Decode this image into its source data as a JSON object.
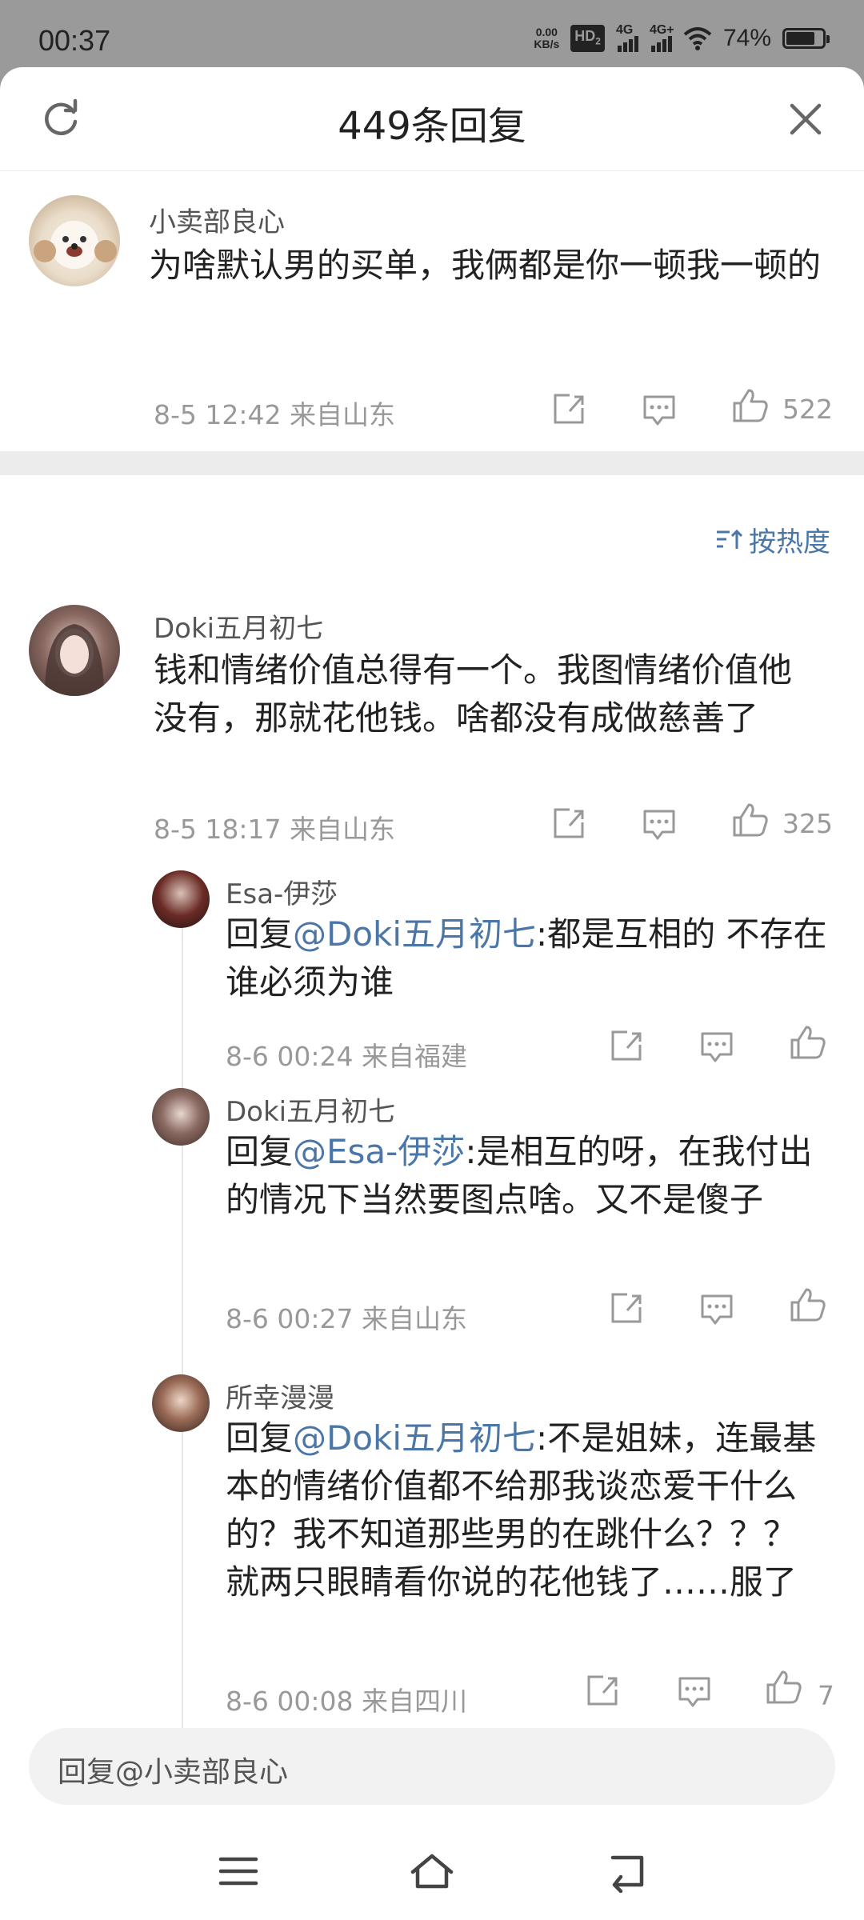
{
  "status_bar": {
    "time": "00:37",
    "net_speed_value": "0.00",
    "net_speed_unit": "KB/s",
    "hd": "HD",
    "hd_sub": "2",
    "sim1": "4G",
    "sim2": "4G+",
    "battery": "74%"
  },
  "header": {
    "title": "449条回复"
  },
  "main_comment": {
    "author": "小卖部良心",
    "text": "为啥默认男的买单，我俩都是你一顿我一顿的",
    "date": "8-5 12:42",
    "location": "来自山东",
    "likes": "522"
  },
  "sort": {
    "label": "按热度"
  },
  "replies": [
    {
      "author": "Doki五月初七",
      "text": "钱和情绪价值总得有一个。我图情绪价值他没有，那就花他钱。啥都没有成做慈善了",
      "date": "8-5 18:17",
      "location": "来自山东",
      "likes": "325"
    }
  ],
  "sub_replies": [
    {
      "author": "Esa-伊莎",
      "reply_prefix": "回复",
      "mention": "@Doki五月初七",
      "text": ":都是互相的 不存在谁必须为谁",
      "date": "8-6 00:24",
      "location": "来自福建",
      "likes": ""
    },
    {
      "author": "Doki五月初七",
      "reply_prefix": "回复",
      "mention": "@Esa-伊莎",
      "text": ":是相互的呀，在我付出的情况下当然要图点啥。又不是傻子",
      "date": "8-6 00:27",
      "location": "来自山东",
      "likes": ""
    },
    {
      "author": "所幸漫漫",
      "reply_prefix": "回复",
      "mention": "@Doki五月初七",
      "text": ":不是姐妹，连最基本的情绪价值都不给那我谈恋爱干什么的？我不知道那些男的在跳什么？？？就两只眼睛看你说的花他钱了……服了",
      "date": "8-6 00:08",
      "location": "来自四川",
      "likes": "7"
    }
  ],
  "reply_input": {
    "placeholder": "回复@小卖部良心"
  },
  "colors": {
    "accent": "#4a76a8",
    "meta": "#999999",
    "status_bg": "#9a9a9a"
  }
}
